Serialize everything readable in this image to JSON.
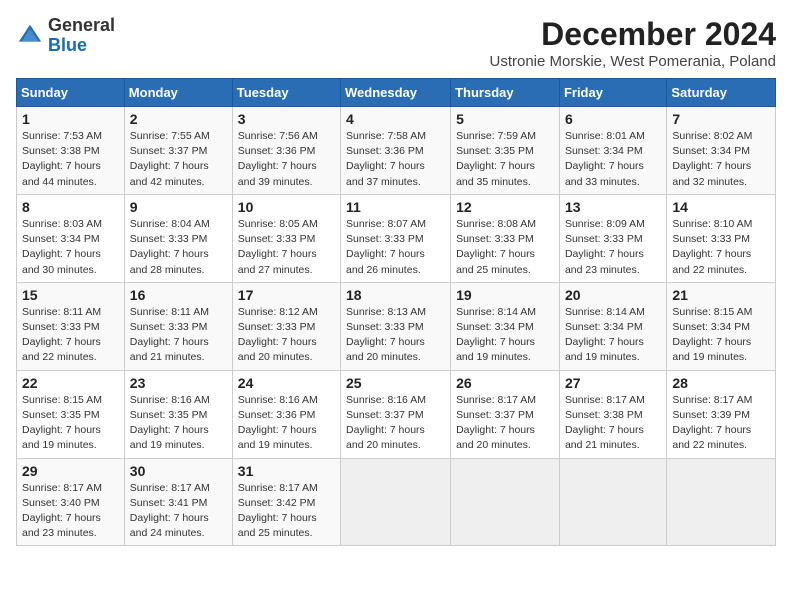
{
  "header": {
    "logo_line1": "General",
    "logo_line2": "Blue",
    "month_title": "December 2024",
    "subtitle": "Ustronie Morskie, West Pomerania, Poland"
  },
  "weekdays": [
    "Sunday",
    "Monday",
    "Tuesday",
    "Wednesday",
    "Thursday",
    "Friday",
    "Saturday"
  ],
  "weeks": [
    [
      {
        "day": "1",
        "sunrise": "7:53 AM",
        "sunset": "3:38 PM",
        "daylight": "7 hours and 44 minutes"
      },
      {
        "day": "2",
        "sunrise": "7:55 AM",
        "sunset": "3:37 PM",
        "daylight": "7 hours and 42 minutes"
      },
      {
        "day": "3",
        "sunrise": "7:56 AM",
        "sunset": "3:36 PM",
        "daylight": "7 hours and 39 minutes"
      },
      {
        "day": "4",
        "sunrise": "7:58 AM",
        "sunset": "3:36 PM",
        "daylight": "7 hours and 37 minutes"
      },
      {
        "day": "5",
        "sunrise": "7:59 AM",
        "sunset": "3:35 PM",
        "daylight": "7 hours and 35 minutes"
      },
      {
        "day": "6",
        "sunrise": "8:01 AM",
        "sunset": "3:34 PM",
        "daylight": "7 hours and 33 minutes"
      },
      {
        "day": "7",
        "sunrise": "8:02 AM",
        "sunset": "3:34 PM",
        "daylight": "7 hours and 32 minutes"
      }
    ],
    [
      {
        "day": "8",
        "sunrise": "8:03 AM",
        "sunset": "3:34 PM",
        "daylight": "7 hours and 30 minutes"
      },
      {
        "day": "9",
        "sunrise": "8:04 AM",
        "sunset": "3:33 PM",
        "daylight": "7 hours and 28 minutes"
      },
      {
        "day": "10",
        "sunrise": "8:05 AM",
        "sunset": "3:33 PM",
        "daylight": "7 hours and 27 minutes"
      },
      {
        "day": "11",
        "sunrise": "8:07 AM",
        "sunset": "3:33 PM",
        "daylight": "7 hours and 26 minutes"
      },
      {
        "day": "12",
        "sunrise": "8:08 AM",
        "sunset": "3:33 PM",
        "daylight": "7 hours and 25 minutes"
      },
      {
        "day": "13",
        "sunrise": "8:09 AM",
        "sunset": "3:33 PM",
        "daylight": "7 hours and 23 minutes"
      },
      {
        "day": "14",
        "sunrise": "8:10 AM",
        "sunset": "3:33 PM",
        "daylight": "7 hours and 22 minutes"
      }
    ],
    [
      {
        "day": "15",
        "sunrise": "8:11 AM",
        "sunset": "3:33 PM",
        "daylight": "7 hours and 22 minutes"
      },
      {
        "day": "16",
        "sunrise": "8:11 AM",
        "sunset": "3:33 PM",
        "daylight": "7 hours and 21 minutes"
      },
      {
        "day": "17",
        "sunrise": "8:12 AM",
        "sunset": "3:33 PM",
        "daylight": "7 hours and 20 minutes"
      },
      {
        "day": "18",
        "sunrise": "8:13 AM",
        "sunset": "3:33 PM",
        "daylight": "7 hours and 20 minutes"
      },
      {
        "day": "19",
        "sunrise": "8:14 AM",
        "sunset": "3:34 PM",
        "daylight": "7 hours and 19 minutes"
      },
      {
        "day": "20",
        "sunrise": "8:14 AM",
        "sunset": "3:34 PM",
        "daylight": "7 hours and 19 minutes"
      },
      {
        "day": "21",
        "sunrise": "8:15 AM",
        "sunset": "3:34 PM",
        "daylight": "7 hours and 19 minutes"
      }
    ],
    [
      {
        "day": "22",
        "sunrise": "8:15 AM",
        "sunset": "3:35 PM",
        "daylight": "7 hours and 19 minutes"
      },
      {
        "day": "23",
        "sunrise": "8:16 AM",
        "sunset": "3:35 PM",
        "daylight": "7 hours and 19 minutes"
      },
      {
        "day": "24",
        "sunrise": "8:16 AM",
        "sunset": "3:36 PM",
        "daylight": "7 hours and 19 minutes"
      },
      {
        "day": "25",
        "sunrise": "8:16 AM",
        "sunset": "3:37 PM",
        "daylight": "7 hours and 20 minutes"
      },
      {
        "day": "26",
        "sunrise": "8:17 AM",
        "sunset": "3:37 PM",
        "daylight": "7 hours and 20 minutes"
      },
      {
        "day": "27",
        "sunrise": "8:17 AM",
        "sunset": "3:38 PM",
        "daylight": "7 hours and 21 minutes"
      },
      {
        "day": "28",
        "sunrise": "8:17 AM",
        "sunset": "3:39 PM",
        "daylight": "7 hours and 22 minutes"
      }
    ],
    [
      {
        "day": "29",
        "sunrise": "8:17 AM",
        "sunset": "3:40 PM",
        "daylight": "7 hours and 23 minutes"
      },
      {
        "day": "30",
        "sunrise": "8:17 AM",
        "sunset": "3:41 PM",
        "daylight": "7 hours and 24 minutes"
      },
      {
        "day": "31",
        "sunrise": "8:17 AM",
        "sunset": "3:42 PM",
        "daylight": "7 hours and 25 minutes"
      },
      null,
      null,
      null,
      null
    ]
  ]
}
